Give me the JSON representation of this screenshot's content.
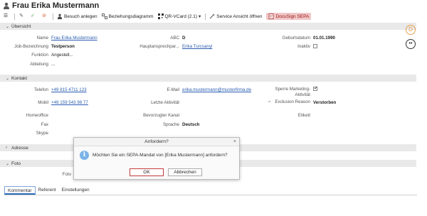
{
  "header": {
    "title": "Frau Erika Mustermann"
  },
  "toolbar": {
    "menu": "☰",
    "edit": "✎",
    "confirm": "✓",
    "cancel": "⊘",
    "besuch": "Besuch anlegen",
    "beziehung": "Beziehungsdiagramm",
    "qr": "QR-VCard (2.1)",
    "qr_arrow": "▾",
    "service": "Service Ansicht öffnen",
    "docusign": "DocuSign SEPA"
  },
  "sections": {
    "uebersicht": "Übersicht",
    "kontakt": "Kontakt",
    "adresse": "Adresse",
    "foto": "Foto"
  },
  "uebersicht": {
    "name_label": "Name",
    "name_value": "Frau Erika Mustermann",
    "job_label": "Job-Bezeichnung",
    "job_value": "Testperson",
    "funktion_label": "Funktion",
    "funktion_value": "Angestell...",
    "abteilung_label": "Abteilung",
    "abteilung_value": "...",
    "abc_label": "ABC",
    "abc_value": "D",
    "haupt_label": "Hauptansprechpar...",
    "haupt_value": "Erika Turcsanyi",
    "geburt_label": "Geburtsdatum",
    "geburt_value": "01.01.1990",
    "inaktiv_label": "Inaktiv"
  },
  "kontakt": {
    "telefon_label": "Telefon",
    "telefon_value": "+49 815 4711 123",
    "mobil_label": "Mobil",
    "mobil_value": "+49 159 543 98 77",
    "homeoffice_label": "Homeoffice",
    "fax_label": "Fax",
    "skype_label": "Skype",
    "email_label": "E-Mail",
    "email_value": "erika.mustermann@musterfirma.de",
    "letzte_label": "Letzte Aktivität",
    "bevorzugt_label": "Bevorzugter Kanal",
    "sprache_label": "Sprache",
    "sprache_value": "Deutsch",
    "sperre_label": "Sperre Marketing-Aktivität",
    "exclusion_label": "Exclusion Reason",
    "exclusion_value": "Verstorben",
    "etikett_label": "Etikett"
  },
  "foto": {
    "label": "Foto"
  },
  "side": {
    "d_badge": "D",
    "more": "••"
  },
  "tabs": [
    "Kommentar",
    "Referent",
    "Einstellungen"
  ],
  "dialog": {
    "title": "Anfordern?",
    "close": "×",
    "message": "Möchten Sie ein SEPA-Mandat von [Erika Mustermann] anfordern?",
    "ok": "OK",
    "cancel": "Abbrechen"
  }
}
